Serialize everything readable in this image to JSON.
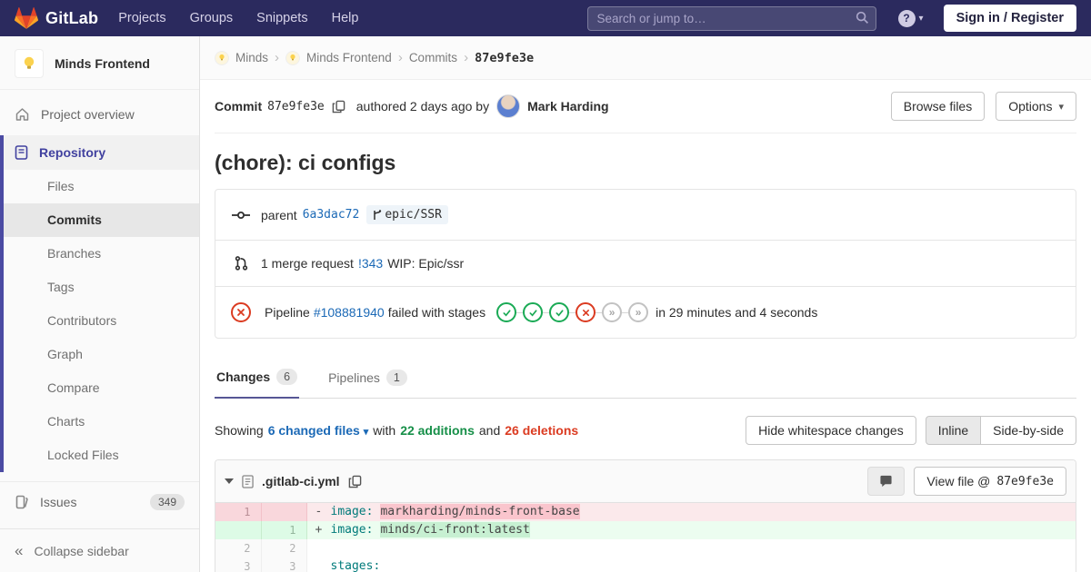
{
  "navbar": {
    "brand": "GitLab",
    "links": [
      "Projects",
      "Groups",
      "Snippets",
      "Help"
    ],
    "search_placeholder": "Search or jump to…",
    "help_glyph": "?",
    "sign_in_label": "Sign in / Register"
  },
  "sidebar": {
    "project_name": "Minds Frontend",
    "overview_label": "Project overview",
    "repository_label": "Repository",
    "repo_items": [
      "Files",
      "Commits",
      "Branches",
      "Tags",
      "Contributors",
      "Graph",
      "Compare",
      "Charts",
      "Locked Files"
    ],
    "active_repo_item": "Commits",
    "issues_label": "Issues",
    "issues_count": "349",
    "collapse_label": "Collapse sidebar"
  },
  "breadcrumb": {
    "group": "Minds",
    "project": "Minds Frontend",
    "section": "Commits",
    "current": "87e9fe3e"
  },
  "commit": {
    "label": "Commit",
    "sha": "87e9fe3e",
    "authored_text": "authored 2 days ago by",
    "author_name": "Mark Harding",
    "browse_files_label": "Browse files",
    "options_label": "Options",
    "title": "(chore): ci configs",
    "parent": {
      "label": "parent",
      "sha": "6a3dac72",
      "ref": "epic/SSR"
    },
    "merge_request": {
      "count_text": "1 merge request",
      "id": "!343",
      "title": "WIP: Epic/ssr"
    },
    "pipeline": {
      "label": "Pipeline",
      "id": "#108881940",
      "status_text": "failed with stages",
      "duration_text": "in 29 minutes and 4 seconds",
      "stages": [
        "passed",
        "passed",
        "passed",
        "failed",
        "skipped",
        "skipped"
      ]
    }
  },
  "tabs": {
    "changes": {
      "label": "Changes",
      "count": "6"
    },
    "pipelines": {
      "label": "Pipelines",
      "count": "1"
    }
  },
  "summary": {
    "showing": "Showing",
    "changed_files": "6 changed files",
    "with": "with",
    "additions": "22 additions",
    "and": "and",
    "deletions": "26 deletions",
    "hide_whitespace": "Hide whitespace changes",
    "inline": "Inline",
    "side_by_side": "Side-by-side"
  },
  "diff_file": {
    "name": ".gitlab-ci.yml",
    "view_file_label": "View file @ ",
    "view_file_sha": "87e9fe3e",
    "lines": [
      {
        "old_num": "1",
        "new_num": "",
        "sign": "-",
        "key": "image:",
        "value": "markharding/minds-front-base"
      },
      {
        "old_num": "",
        "new_num": "1",
        "sign": "+",
        "key": "image:",
        "value": "minds/ci-front:latest"
      },
      {
        "old_num": "2",
        "new_num": "2",
        "sign": "",
        "key": "",
        "value": ""
      },
      {
        "old_num": "3",
        "new_num": "3",
        "sign": "",
        "key": "stages:",
        "value": ""
      }
    ]
  },
  "icons": {
    "chevron_right": "›",
    "caret_down": "▾",
    "collapse": "«",
    "skipped": "»"
  },
  "colors": {
    "navbar_bg": "#2b2a5e",
    "accent_purple": "#4b4ba3",
    "link_blue": "#1b69b6",
    "success_green": "#1aaa55",
    "danger_red": "#db3b21"
  }
}
